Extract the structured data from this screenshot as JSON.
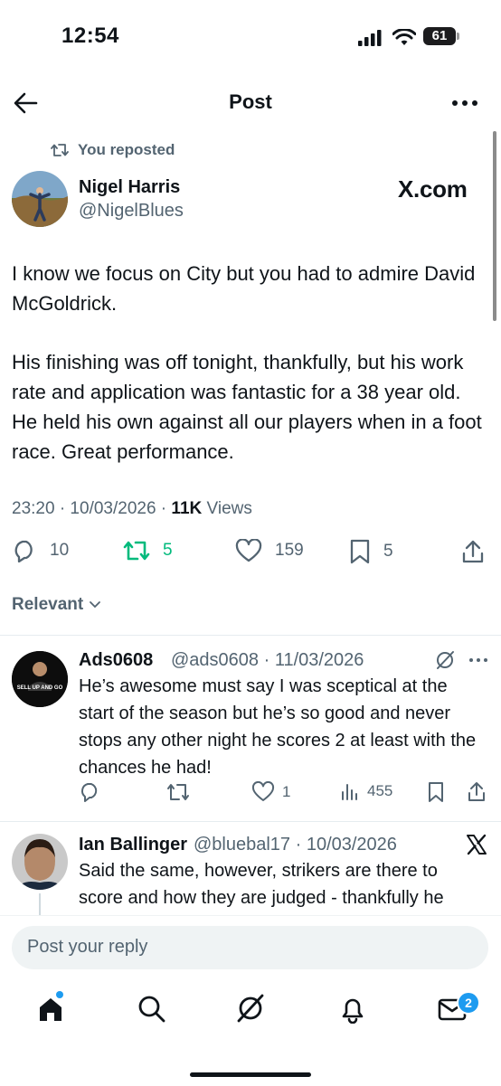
{
  "status_bar": {
    "time": "12:54",
    "battery": "61"
  },
  "header": {
    "title": "Post"
  },
  "repost": {
    "label": "You reposted"
  },
  "post": {
    "author_name": "Nigel Harris",
    "author_handle": "@NigelBlues",
    "site_label": "X.com",
    "paragraph1": "I know we focus on City but you had to admire David McGoldrick.",
    "paragraph2": "His finishing was off tonight, thankfully, but his work rate and application was fantastic for a 38 year old. He held his own against all our players when in a foot race.  Great performance.",
    "timestamp": "23:20 · 10/03/2026 · ",
    "views_count": "11K",
    "views_label": " Views",
    "replies": "10",
    "reposts": "5",
    "likes": "159",
    "bookmarks": "5"
  },
  "sort": {
    "label": "Relevant"
  },
  "replies": [
    {
      "name": "Ads0608",
      "handle": "@ads0608 · 11/03/2026",
      "avatar_text": "SELL UP AND GO",
      "text": "He’s awesome must say I was sceptical at the start of the season but he’s so good and never stops any other night he scores 2 at least with the chances he had!",
      "likes": "1",
      "views": "455"
    },
    {
      "name": "Ian Ballinger",
      "handle": "@bluebal17 · 10/03/2026",
      "text": "Said the same, however, strikers are there to score and how they are judged - thankfully he failed that test!"
    }
  ],
  "composer": {
    "placeholder": "Post your reply"
  },
  "bottom_nav": {
    "messages_badge": "2"
  },
  "colors": {
    "accent": "#1d9bf0",
    "repost_green": "#00ba7c",
    "muted": "#536471"
  }
}
